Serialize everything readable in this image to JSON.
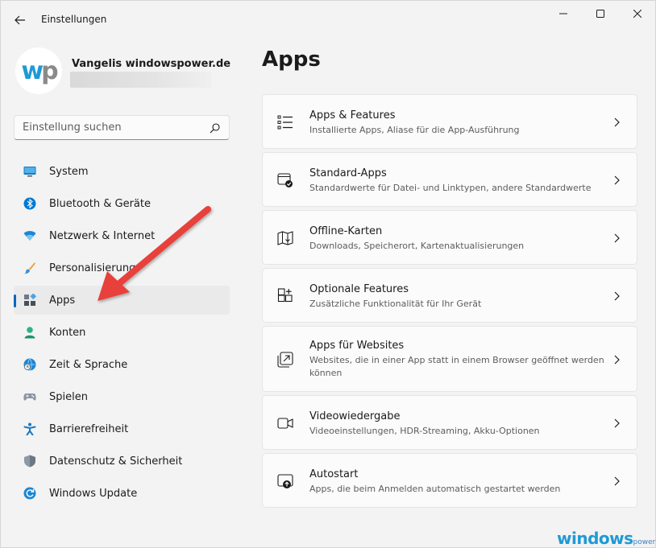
{
  "window": {
    "title": "Einstellungen"
  },
  "profile": {
    "name": "Vangelis windowspower.de",
    "avatar_letters": [
      "w",
      "p"
    ]
  },
  "search": {
    "placeholder": "Einstellung suchen"
  },
  "nav": {
    "items": [
      {
        "label": "System",
        "icon": "monitor-icon",
        "active": false
      },
      {
        "label": "Bluetooth & Geräte",
        "icon": "bluetooth-icon",
        "active": false
      },
      {
        "label": "Netzwerk & Internet",
        "icon": "wifi-icon",
        "active": false
      },
      {
        "label": "Personalisierung",
        "icon": "brush-icon",
        "active": false
      },
      {
        "label": "Apps",
        "icon": "apps-icon",
        "active": true
      },
      {
        "label": "Konten",
        "icon": "person-icon",
        "active": false
      },
      {
        "label": "Zeit & Sprache",
        "icon": "globe-clock-icon",
        "active": false
      },
      {
        "label": "Spielen",
        "icon": "gamepad-icon",
        "active": false
      },
      {
        "label": "Barrierefreiheit",
        "icon": "accessibility-icon",
        "active": false
      },
      {
        "label": "Datenschutz & Sicherheit",
        "icon": "shield-icon",
        "active": false
      },
      {
        "label": "Windows Update",
        "icon": "update-icon",
        "active": false
      }
    ]
  },
  "main": {
    "title": "Apps",
    "cards": [
      {
        "title": "Apps & Features",
        "desc": "Installierte Apps, Aliase für die App-Ausführung",
        "icon": "list-icon"
      },
      {
        "title": "Standard-Apps",
        "desc": "Standardwerte für Datei- und Linktypen, andere Standardwerte",
        "icon": "default-apps-icon"
      },
      {
        "title": "Offline-Karten",
        "desc": "Downloads, Speicherort, Kartenaktualisierungen",
        "icon": "map-icon"
      },
      {
        "title": "Optionale Features",
        "desc": "Zusätzliche Funktionalität für Ihr Gerät",
        "icon": "optional-features-icon"
      },
      {
        "title": "Apps für Websites",
        "desc": "Websites, die in einer App statt in einem Browser geöffnet werden können",
        "icon": "open-in-app-icon"
      },
      {
        "title": "Videowiedergabe",
        "desc": "Videoeinstellungen, HDR-Streaming, Akku-Optionen",
        "icon": "video-icon"
      },
      {
        "title": "Autostart",
        "desc": "Apps, die beim Anmelden automatisch gestartet werden",
        "icon": "startup-icon"
      }
    ]
  },
  "watermark": {
    "main": "windows",
    "small": "power"
  },
  "colors": {
    "accent": "#0067c0",
    "arrow": "#e8413a",
    "brand": "#1e9ad6"
  }
}
